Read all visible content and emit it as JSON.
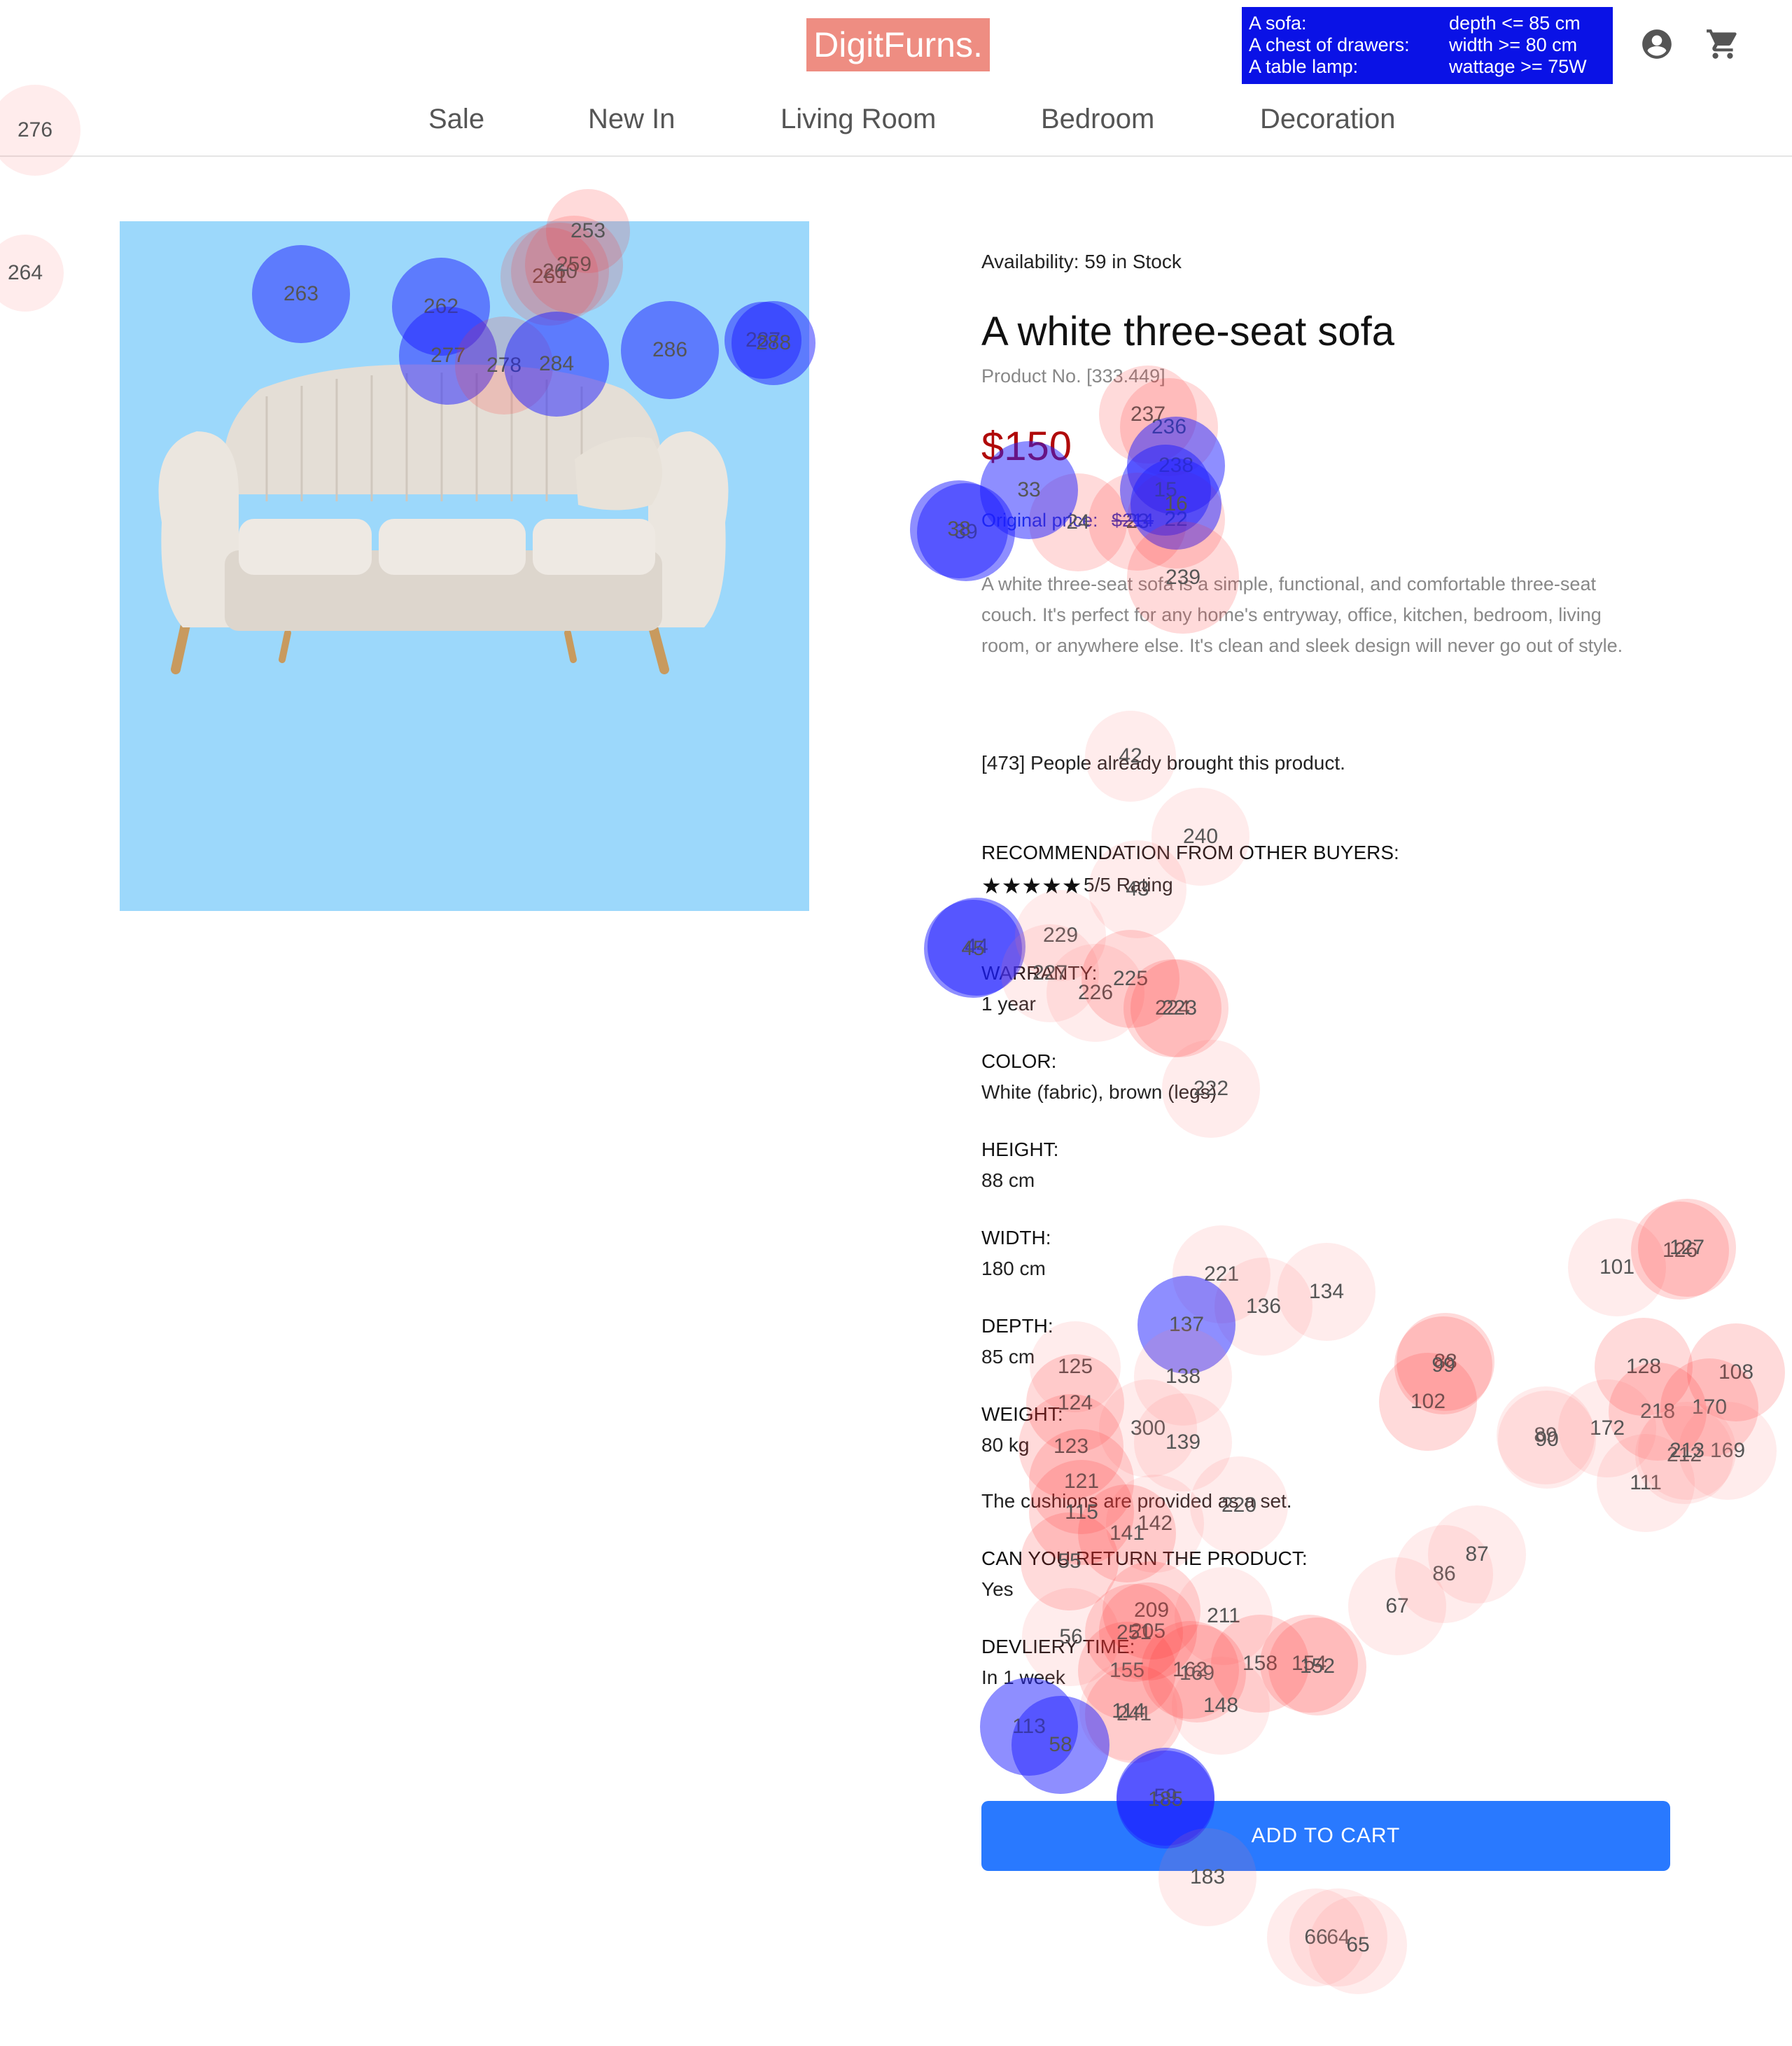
{
  "header": {
    "logo": "DigitFurns.",
    "requirements": [
      {
        "item": "A sofa:",
        "condition": "depth <= 85 cm"
      },
      {
        "item": "A chest of drawers:",
        "condition": "width >= 80 cm"
      },
      {
        "item": "A table lamp:",
        "condition": "wattage >= 75W"
      }
    ],
    "icons": {
      "account": "account-circle-icon",
      "cart": "shopping-cart-icon"
    }
  },
  "nav": [
    "Sale",
    "New In",
    "Living Room",
    "Bedroom",
    "Decoration"
  ],
  "product": {
    "availability": "Availability: 59 in Stock",
    "title": "A white three-seat sofa",
    "product_no": "Product No. [333.449]",
    "price": "$150",
    "original_label": "Original price:",
    "original_price": "$214",
    "description": "A white three-seat sofa is a simple, functional, and comfortable three-seat couch. It's perfect for any home's entryway, office, kitchen, bedroom, living room, or anywhere else. It's clean and sleek design will never go out of style.",
    "bought": "[473] People already brought this product.",
    "recommendation_label": "RECOMMENDATION FROM OTHER BUYERS:",
    "rating_stars": "★★★★★",
    "rating_text": "5/5 Rating",
    "rating_value": 5,
    "specs": [
      {
        "label": "WARRANTY:",
        "value": "1 year"
      },
      {
        "label": "COLOR:",
        "value": "White (fabric), brown (legs)"
      },
      {
        "label": "HEIGHT:",
        "value": "88 cm"
      },
      {
        "label": "WIDTH:",
        "value": "180 cm"
      },
      {
        "label": "DEPTH:",
        "value": "85 cm"
      },
      {
        "label": "WEIGHT:",
        "value": "80 kg"
      }
    ],
    "cushions_note": "The cushions are provided as a set.",
    "return_label": "CAN YOU RETURN THE PRODUCT:",
    "return_value": "Yes",
    "delivery_label": "DEVLIERY TIME:",
    "delivery_value": "In 1 week",
    "add_to_cart": "ADD TO CART"
  },
  "overlay_labels": [
    "276",
    "264",
    "263",
    "262",
    "261",
    "260",
    "259",
    "253",
    "277",
    "278",
    "284",
    "286",
    "287",
    "288",
    "237",
    "236",
    "238",
    "24",
    "23",
    "22",
    "39",
    "38",
    "33",
    "15",
    "16",
    "239",
    "42",
    "240",
    "43",
    "44",
    "45",
    "229",
    "227",
    "226",
    "225",
    "224",
    "223",
    "222",
    "221",
    "136",
    "134",
    "137",
    "138",
    "125",
    "124",
    "123",
    "300",
    "139",
    "121",
    "142",
    "141",
    "115",
    "220",
    "56",
    "55",
    "209",
    "211",
    "205",
    "251",
    "155",
    "162",
    "169",
    "158",
    "154",
    "152",
    "148",
    "241",
    "114",
    "113",
    "58",
    "59",
    "185",
    "183",
    "64",
    "66",
    "65",
    "67",
    "86",
    "87",
    "88",
    "102",
    "99",
    "101",
    "126",
    "127",
    "128",
    "108",
    "218",
    "172",
    "170",
    "169",
    "111",
    "212",
    "213",
    "89",
    "90"
  ]
}
